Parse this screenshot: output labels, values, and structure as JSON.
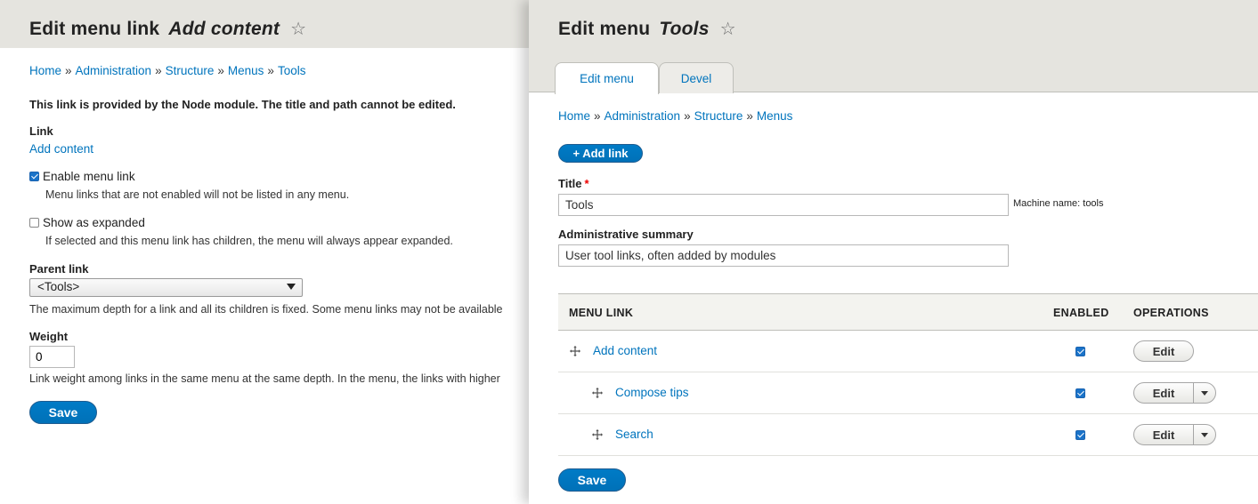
{
  "left": {
    "title_prefix": "Edit menu link",
    "title_em": "Add content",
    "star": "☆",
    "breadcrumb": [
      "Home",
      "Administration",
      "Structure",
      "Menus",
      "Tools"
    ],
    "breadcrumb_sep": "»",
    "notice": "This link is provided by the Node module. The title and path cannot be edited.",
    "link_label": "Link",
    "link_value": "Add content",
    "enable_label": "Enable menu link",
    "enable_checked": true,
    "enable_desc": "Menu links that are not enabled will not be listed in any menu.",
    "expanded_label": "Show as expanded",
    "expanded_checked": false,
    "expanded_desc": "If selected and this menu link has children, the menu will always appear expanded.",
    "parent_label": "Parent link",
    "parent_value": "<Tools>",
    "parent_desc": "The maximum depth for a link and all its children is fixed. Some menu links may not be available",
    "weight_label": "Weight",
    "weight_value": "0",
    "weight_desc": "Link weight among links in the same menu at the same depth. In the menu, the links with higher",
    "save_label": "Save"
  },
  "right": {
    "title_prefix": "Edit menu",
    "title_em": "Tools",
    "star": "☆",
    "tabs": [
      {
        "label": "Edit menu",
        "active": true
      },
      {
        "label": "Devel",
        "active": false
      }
    ],
    "breadcrumb": [
      "Home",
      "Administration",
      "Structure",
      "Menus"
    ],
    "breadcrumb_sep": "»",
    "add_link_label": "+ Add link",
    "title_label": "Title",
    "required_mark": "*",
    "title_value": "Tools",
    "machine_name": "Machine name: tools",
    "summary_label": "Administrative summary",
    "summary_value": "User tool links, often added by modules",
    "table": {
      "headers": [
        "MENU LINK",
        "ENABLED",
        "OPERATIONS"
      ],
      "rows": [
        {
          "title": "Add content",
          "depth": 0,
          "enabled": true,
          "op": "Edit",
          "has_dropdown": false
        },
        {
          "title": "Compose tips",
          "depth": 1,
          "enabled": true,
          "op": "Edit",
          "has_dropdown": true
        },
        {
          "title": "Search",
          "depth": 1,
          "enabled": true,
          "op": "Edit",
          "has_dropdown": true
        }
      ]
    },
    "save_label": "Save"
  },
  "colors": {
    "link": "#0074bd",
    "header_bg": "#e5e4df",
    "primary_button": "#0071b8",
    "required": "#ee0000"
  },
  "icons": {
    "favorite": "star-outline-icon",
    "drag": "drag-handle-icon",
    "dropdown": "caret-down-icon"
  }
}
